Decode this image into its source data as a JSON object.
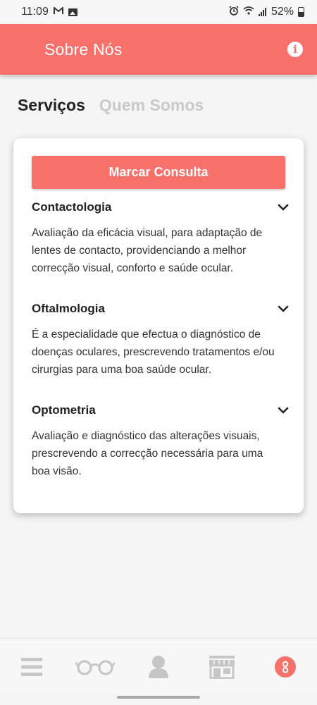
{
  "status_bar": {
    "time": "11:09",
    "battery": "52%"
  },
  "app_bar": {
    "title": "Sobre Nós",
    "info_icon": "info-icon"
  },
  "tabs": [
    {
      "label": "Serviços",
      "active": true
    },
    {
      "label": "Quem Somos",
      "active": false
    }
  ],
  "card": {
    "button_label": "Marcar Consulta",
    "services": [
      {
        "title": "Contactologia",
        "description": "Avaliação da eficácia visual, para adaptação de lentes de contacto, providenciando a melhor correcção visual, conforto e saúde ocular."
      },
      {
        "title": "Oftalmologia",
        "description": "É a especialidade que efectua o diagnóstico de doenças oculares, prescrevendo tratamentos e/ou cirurgias para uma boa saúde ocular."
      },
      {
        "title": "Optometria",
        "description": "Avaliação e diagnóstico das alterações visuais, prescrevendo a correcção necessária para uma boa visão."
      }
    ]
  },
  "bottom_nav": [
    {
      "icon": "menu-icon",
      "active": false
    },
    {
      "icon": "glasses-icon",
      "active": false
    },
    {
      "icon": "person-icon",
      "active": false
    },
    {
      "icon": "store-icon",
      "active": false
    },
    {
      "icon": "about-icon",
      "active": true
    }
  ],
  "colors": {
    "accent": "#f8706a",
    "nav_inactive": "#c6c6c6"
  }
}
